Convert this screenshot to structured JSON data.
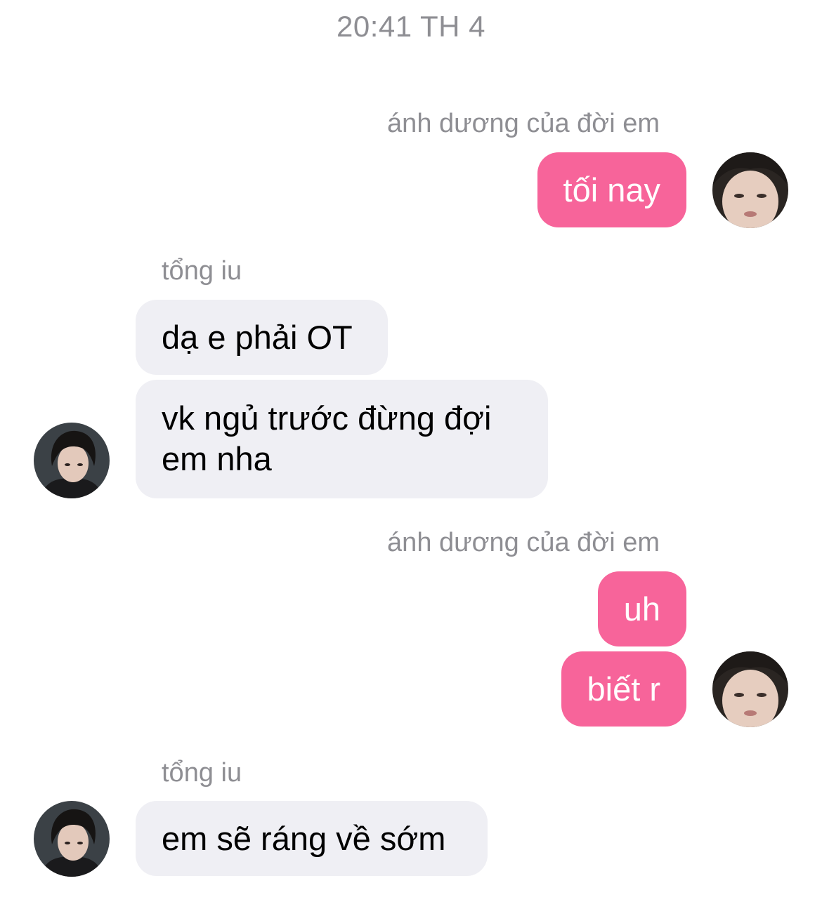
{
  "conversation": {
    "timestamp": "20:41 TH 4",
    "sender_out": "ánh dương của đời em",
    "sender_in": "tổng iu",
    "messages": [
      {
        "from": "out",
        "text": "tối nay"
      },
      {
        "from": "in",
        "text": "dạ e phải OT"
      },
      {
        "from": "in",
        "text": "vk ngủ trước đừng đợi em nha"
      },
      {
        "from": "out",
        "text": "uh"
      },
      {
        "from": "out",
        "text": "biết r"
      },
      {
        "from": "in",
        "text": "em sẽ ráng về sớm"
      }
    ]
  },
  "colors": {
    "outgoing_bubble": "#f7649a",
    "incoming_bubble": "#efeff4",
    "meta_text": "#8e8e93"
  },
  "icons": {
    "outgoing_avatar": "avatar-photo-female",
    "incoming_avatar": "avatar-photo-male"
  }
}
